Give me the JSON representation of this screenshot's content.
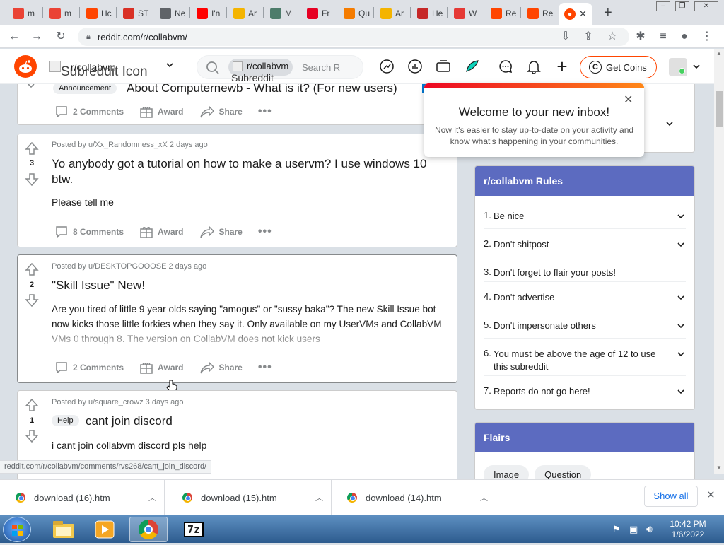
{
  "browser": {
    "tabs": [
      {
        "label": "m",
        "icon": "gmail-icon",
        "color": "#ea4335"
      },
      {
        "label": "m",
        "icon": "gmail-icon",
        "color": "#ea4335"
      },
      {
        "label": "Hc",
        "icon": "reddit-icon",
        "color": "#ff4500"
      },
      {
        "label": "ST",
        "icon": "stop-icon",
        "color": "#d93025"
      },
      {
        "label": "Ne",
        "icon": "globe-icon",
        "color": "#5f6368"
      },
      {
        "label": "I'n",
        "icon": "youtube-icon",
        "color": "#ff0000"
      },
      {
        "label": "Ar",
        "icon": "emoji-icon",
        "color": "#f4b400"
      },
      {
        "label": "M",
        "icon": "cat-icon",
        "color": "#4d7c6b"
      },
      {
        "label": "Fr",
        "icon": "pinterest-icon",
        "color": "#e60023"
      },
      {
        "label": "Qu",
        "icon": "quiz-icon",
        "color": "#f57c00"
      },
      {
        "label": "Ar",
        "icon": "emoji-icon",
        "color": "#f4b400"
      },
      {
        "label": "He",
        "icon": "help-icon",
        "color": "#c62828"
      },
      {
        "label": "W",
        "icon": "w-icon",
        "color": "#e53935"
      },
      {
        "label": "Re",
        "icon": "reddit-icon",
        "color": "#ff4500"
      },
      {
        "label": "Re",
        "icon": "reddit-icon",
        "color": "#ff4500"
      }
    ],
    "url": "reddit.com/r/collabvm/",
    "status_url": "reddit.com/r/collabvm/comments/rvs268/cant_join_discord/"
  },
  "header": {
    "community": "r/collabvm",
    "subreddit_icon_alt": "Subreddit Icon",
    "search_chip": "r/collabvm",
    "search_placeholder": "Search R",
    "search_chip_alt": "Subreddit Icon",
    "get_coins": "Get Coins"
  },
  "popup": {
    "title": "Welcome to your new inbox!",
    "body": "Now it's easier to stay up-to-date on your activity and know what's happening in your communities."
  },
  "posts": [
    {
      "flair": "Announcement",
      "title": "About Computernewb - What is it? (For new users)",
      "comments": "2 Comments",
      "award": "Award",
      "share": "Share"
    },
    {
      "score": "3",
      "meta": "Posted by u/Xx_Randomness_xX 2 days ago",
      "title": "Yo anybody got a tutorial on how to make a uservm? I use windows 10 btw.",
      "body": "Please tell me",
      "comments": "8 Comments",
      "award": "Award",
      "share": "Share"
    },
    {
      "score": "2",
      "meta": "Posted by u/DESKTOPGOOOSE 2 days ago",
      "title": "\"Skill Issue\" New!",
      "body": "Are you tired of little 9 year olds saying \"amogus\" or \"sussy baka\"? The new Skill Issue bot now kicks those little forkies when they say it. Only available on my UserVMs and CollabVM VMs 0 through 8. The version on CollabVM does not kick users",
      "comments": "2 Comments",
      "award": "Award",
      "share": "Share"
    },
    {
      "score": "1",
      "meta": "Posted by u/square_crowz 3 days ago",
      "flair": "Help",
      "title": "cant join discord",
      "body": "i cant join collabvm discord pls help"
    }
  ],
  "rules": {
    "title": "r/collabvm Rules",
    "items": [
      {
        "num": "1.",
        "text": "Be nice"
      },
      {
        "num": "2.",
        "text": "Don't shitpost"
      },
      {
        "num": "3.",
        "text": "Don't forget to flair your posts!"
      },
      {
        "num": "4.",
        "text": "Don't advertise"
      },
      {
        "num": "5.",
        "text": "Don't impersonate others"
      },
      {
        "num": "6.",
        "text": "You must be above the age of 12 to use this subreddit"
      },
      {
        "num": "7.",
        "text": "Reports do not go here!"
      }
    ]
  },
  "flairs": {
    "title": "Flairs",
    "items": [
      "Image",
      "Question"
    ]
  },
  "downloads": {
    "items": [
      "download (16).htm",
      "download (15).htm",
      "download (14).htm"
    ],
    "show_all": "Show all"
  },
  "taskbar": {
    "time": "10:42 PM",
    "date": "1/6/2022"
  },
  "colors": {
    "reddit_orange": "#ff4500",
    "rules_header": "#5c6bc0"
  }
}
